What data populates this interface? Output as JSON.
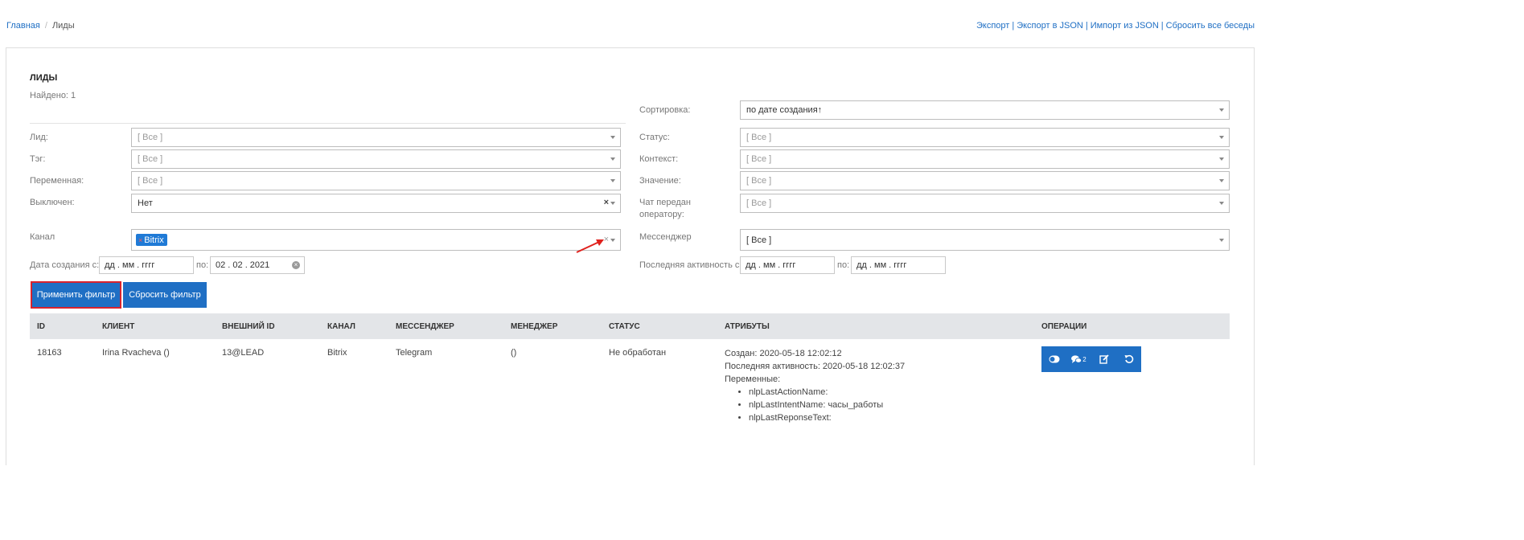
{
  "breadcrumb": {
    "home": "Главная",
    "separator": "/",
    "current": "Лиды"
  },
  "top_links": {
    "export": "Экспорт",
    "export_json": "Экспорт в JSON",
    "import_json": "Импорт из JSON",
    "reset_chats": "Сбросить все беседы",
    "separator": "|"
  },
  "page": {
    "title": "ЛИДЫ",
    "found": "Найдено: 1"
  },
  "filters": {
    "sort": {
      "label": "Сортировка:",
      "value": "по дате создания↑"
    },
    "lead": {
      "label": "Лид:",
      "value": "[ Все ]"
    },
    "status": {
      "label": "Статус:",
      "value": "[ Все ]"
    },
    "tag": {
      "label": "Тэг:",
      "value": "[ Все ]"
    },
    "context": {
      "label": "Контекст:",
      "value": "[ Все ]"
    },
    "variable": {
      "label": "Переменная:",
      "value": "[ Все ]"
    },
    "value_field": {
      "label": "Значение:",
      "value": "[ Все ]"
    },
    "disabled": {
      "label": "Выключен:",
      "value": "Нет",
      "clear": "×"
    },
    "operator": {
      "label_line1": "Чат передан",
      "label_line2": "оператору:",
      "value": "[ Все ]"
    },
    "channel": {
      "label": "Канал",
      "tag_remove": "×",
      "tag": "Bitrix",
      "clear": "×"
    },
    "messenger": {
      "label": "Мессенджер",
      "value": "[ Все ]"
    },
    "created": {
      "label_from": "Дата создания с:",
      "from_placeholder": "дд . мм . гггг",
      "label_to": "по:",
      "to_value": "02 . 02 . 2021",
      "clear": "×"
    },
    "activity": {
      "label_from": "Последняя активность с:",
      "from_placeholder": "дд . мм . гггг",
      "label_to": "по:",
      "to_placeholder": "дд . мм . гггг"
    }
  },
  "buttons": {
    "apply": "Применить фильтр",
    "reset": "Сбросить фильтр"
  },
  "table": {
    "headers": [
      "ID",
      "КЛИЕНТ",
      "ВНЕШНИЙ ID",
      "КАНАЛ",
      "МЕССЕНДЖЕР",
      "МЕНЕДЖЕР",
      "СТАТУС",
      "АТРИБУТЫ",
      "ОПЕРАЦИИ"
    ],
    "rows": [
      {
        "id": "18163",
        "client": "Irina Rvacheva ()",
        "external_id": "13@LEAD",
        "channel": "Bitrix",
        "messenger": "Telegram",
        "manager": "()",
        "status": "Не обработан",
        "attributes": {
          "created": "Создан: 2020-05-18 12:02:12",
          "last_activity": "Последняя активность: 2020-05-18 12:02:37",
          "variables_label": "Переменные:",
          "variables": [
            "nlpLastActionName:",
            "nlpLastIntentName: часы_работы",
            "nlpLastReponseText:"
          ]
        },
        "chat_count": "2"
      }
    ]
  },
  "colors": {
    "primary": "#1f6fc4",
    "highlight": "#d9232d",
    "header_bg": "#e3e5e8"
  }
}
